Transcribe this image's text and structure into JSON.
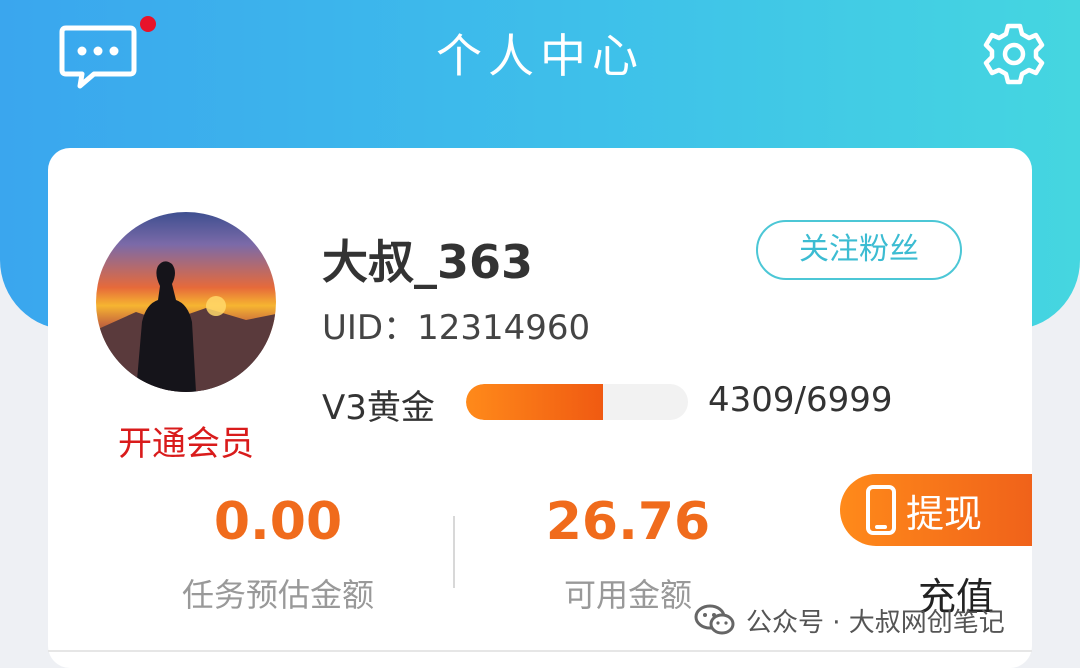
{
  "header": {
    "title": "个人中心",
    "message_icon": "chat-bubble-icon",
    "settings_icon": "gear-icon",
    "has_unread": true
  },
  "profile": {
    "username": "大叔_363",
    "uid_label": "UID：",
    "uid_value": "12314960",
    "follow_label": "关注粉丝",
    "vip_label": "开通会员",
    "level_label": "V3黄金",
    "level_progress_text": "4309/6999",
    "level_progress_fraction": 0.6157
  },
  "stats": [
    {
      "value": "0.00",
      "label": "任务预估金额"
    },
    {
      "value": "26.76",
      "label": "可用金额"
    }
  ],
  "actions": {
    "withdraw_label": "提现",
    "recharge_label": "充值"
  },
  "watermark": {
    "text": "公众号 · 大叔网创笔记"
  },
  "colors": {
    "header_gradient_start": "#3aa6ee",
    "header_gradient_end": "#45d6e0",
    "accent_orange": "#f06b1c",
    "vip_red": "#d91b1b",
    "follow_teal": "#3cbcd2"
  }
}
